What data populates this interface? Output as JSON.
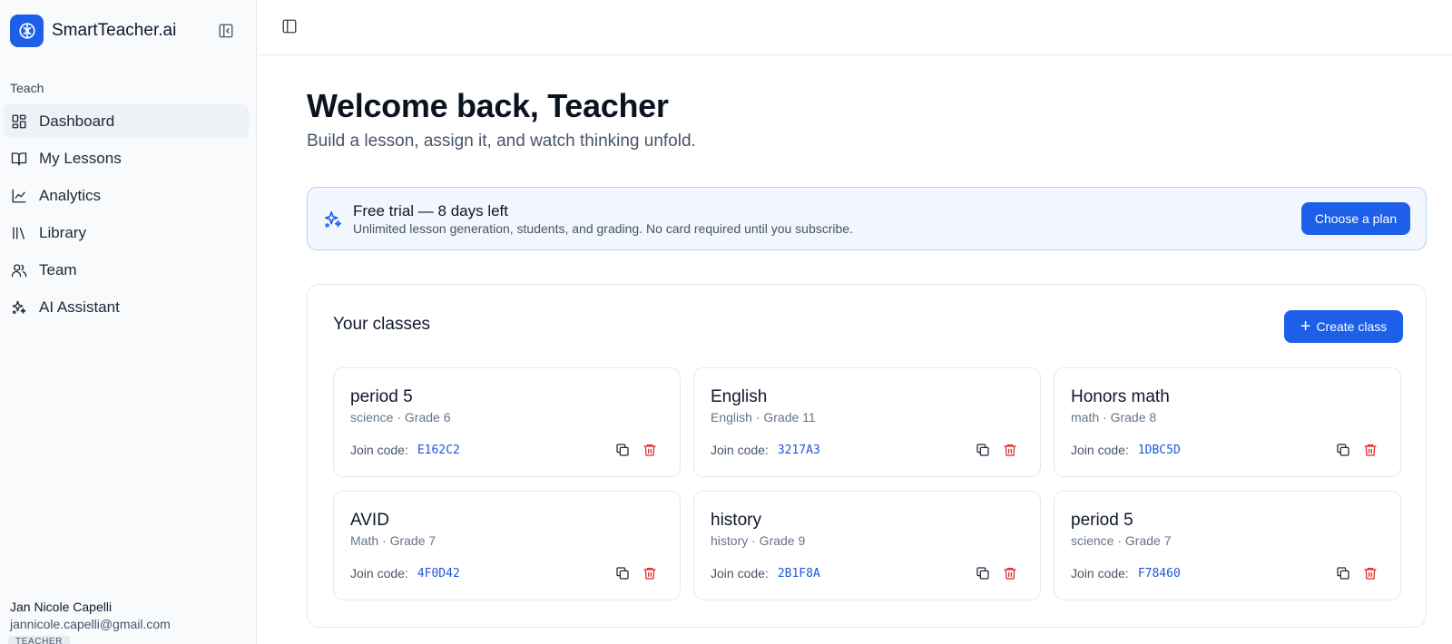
{
  "app": {
    "name": "SmartTeacher.ai"
  },
  "sidebar": {
    "section_label": "Teach",
    "items": [
      {
        "label": "Dashboard",
        "icon": "dashboard-icon",
        "active": true
      },
      {
        "label": "My Lessons",
        "icon": "book-open-icon",
        "active": false
      },
      {
        "label": "Analytics",
        "icon": "line-chart-icon",
        "active": false
      },
      {
        "label": "Library",
        "icon": "library-icon",
        "active": false
      },
      {
        "label": "Team",
        "icon": "users-icon",
        "active": false
      },
      {
        "label": "AI Assistant",
        "icon": "sparkles-icon",
        "active": false
      }
    ],
    "user": {
      "name": "Jan Nicole Capelli",
      "email": "jannicole.capelli@gmail.com",
      "role": "TEACHER"
    }
  },
  "main": {
    "title": "Welcome back, Teacher",
    "subtitle": "Build a lesson, assign it, and watch thinking unfold."
  },
  "trial": {
    "title": "Free trial — 8 days left",
    "description": "Unlimited lesson generation, students, and grading. No card required until you subscribe.",
    "button": "Choose a plan"
  },
  "classes": {
    "title": "Your classes",
    "create_button": "Create class",
    "join_label": "Join code:",
    "items": [
      {
        "name": "period 5",
        "meta": "science · Grade 6",
        "code": "E162C2"
      },
      {
        "name": "English",
        "meta": "English · Grade 11",
        "code": "3217A3"
      },
      {
        "name": "Honors math",
        "meta": "math · Grade 8",
        "code": "1DBC5D"
      },
      {
        "name": "AVID",
        "meta": "Math · Grade 7",
        "code": "4F0D42"
      },
      {
        "name": "history",
        "meta": "history · Grade 9",
        "code": "2B1F8A"
      },
      {
        "name": "period 5",
        "meta": "science · Grade 7",
        "code": "F78460"
      }
    ]
  },
  "colors": {
    "primary": "#1d5fe8",
    "code": "#2157d6",
    "delete": "#dc2626",
    "trial_bg": "#f2f6fe"
  }
}
